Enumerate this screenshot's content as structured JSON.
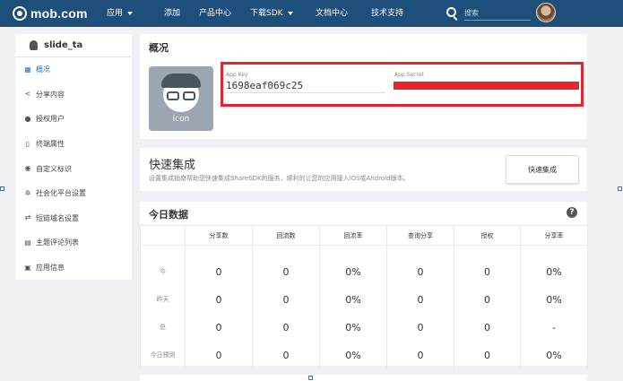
{
  "nav": {
    "logo": "mob.com",
    "items": [
      {
        "label": "应用",
        "dropdown": true
      },
      {
        "label": "添加",
        "dropdown": false
      },
      {
        "label": "产品中心",
        "dropdown": false
      },
      {
        "label": "下载SDK",
        "dropdown": true
      },
      {
        "label": "文档中心",
        "dropdown": false
      },
      {
        "label": "技术支持",
        "dropdown": false
      }
    ],
    "search_placeholder": "搜索"
  },
  "sidebar": {
    "app_name": "slide_ta",
    "items": [
      {
        "label": "概况",
        "icon": "grid-icon",
        "active": true
      },
      {
        "label": "分享内容",
        "icon": "share-icon",
        "active": false
      },
      {
        "label": "授权用户",
        "icon": "user-icon",
        "active": false
      },
      {
        "label": "终端属性",
        "icon": "phone-icon",
        "active": false
      },
      {
        "label": "自定义标识",
        "icon": "pin-icon",
        "active": false
      },
      {
        "label": "社会化平台设置",
        "icon": "gear-icon",
        "active": false
      },
      {
        "label": "短链域名设置",
        "icon": "link-icon",
        "active": false
      },
      {
        "label": "主题评论列表",
        "icon": "comment-icon",
        "active": false
      },
      {
        "label": "应用信息",
        "icon": "info-icon",
        "active": false
      }
    ]
  },
  "overview": {
    "title": "概况",
    "icon_label": "icon",
    "app_key_label": "App Key",
    "app_key_value": "1698eaf069c25",
    "app_secret_label": "App Secret"
  },
  "quick": {
    "title": "快速集成",
    "desc": "设置集成指南帮助您快速集成ShareSDK的服务，顺利的让您的应用接入iOS或Android版本。",
    "button": "快速集成"
  },
  "today": {
    "title": "今日数据",
    "help": "?",
    "columns": [
      "",
      "分享数",
      "回流数",
      "回流率",
      "查询分享",
      "授权",
      "分享率"
    ],
    "rows": [
      {
        "label": "今",
        "values": [
          "0",
          "0",
          "0%",
          "0",
          "0",
          "0%"
        ]
      },
      {
        "label": "昨天",
        "values": [
          "0",
          "0",
          "0%",
          "0",
          "0",
          "0%"
        ]
      },
      {
        "label": "总",
        "values": [
          "0",
          "0",
          "0%",
          "0",
          "0",
          "-"
        ]
      },
      {
        "label": "今日预测",
        "values": [
          "0",
          "0",
          "0%",
          "0",
          "0",
          "0%"
        ]
      }
    ]
  },
  "colors": {
    "nav_bg": "#1e4f7a",
    "accent": "#2a7ac0",
    "highlight_red": "#e3262b"
  }
}
